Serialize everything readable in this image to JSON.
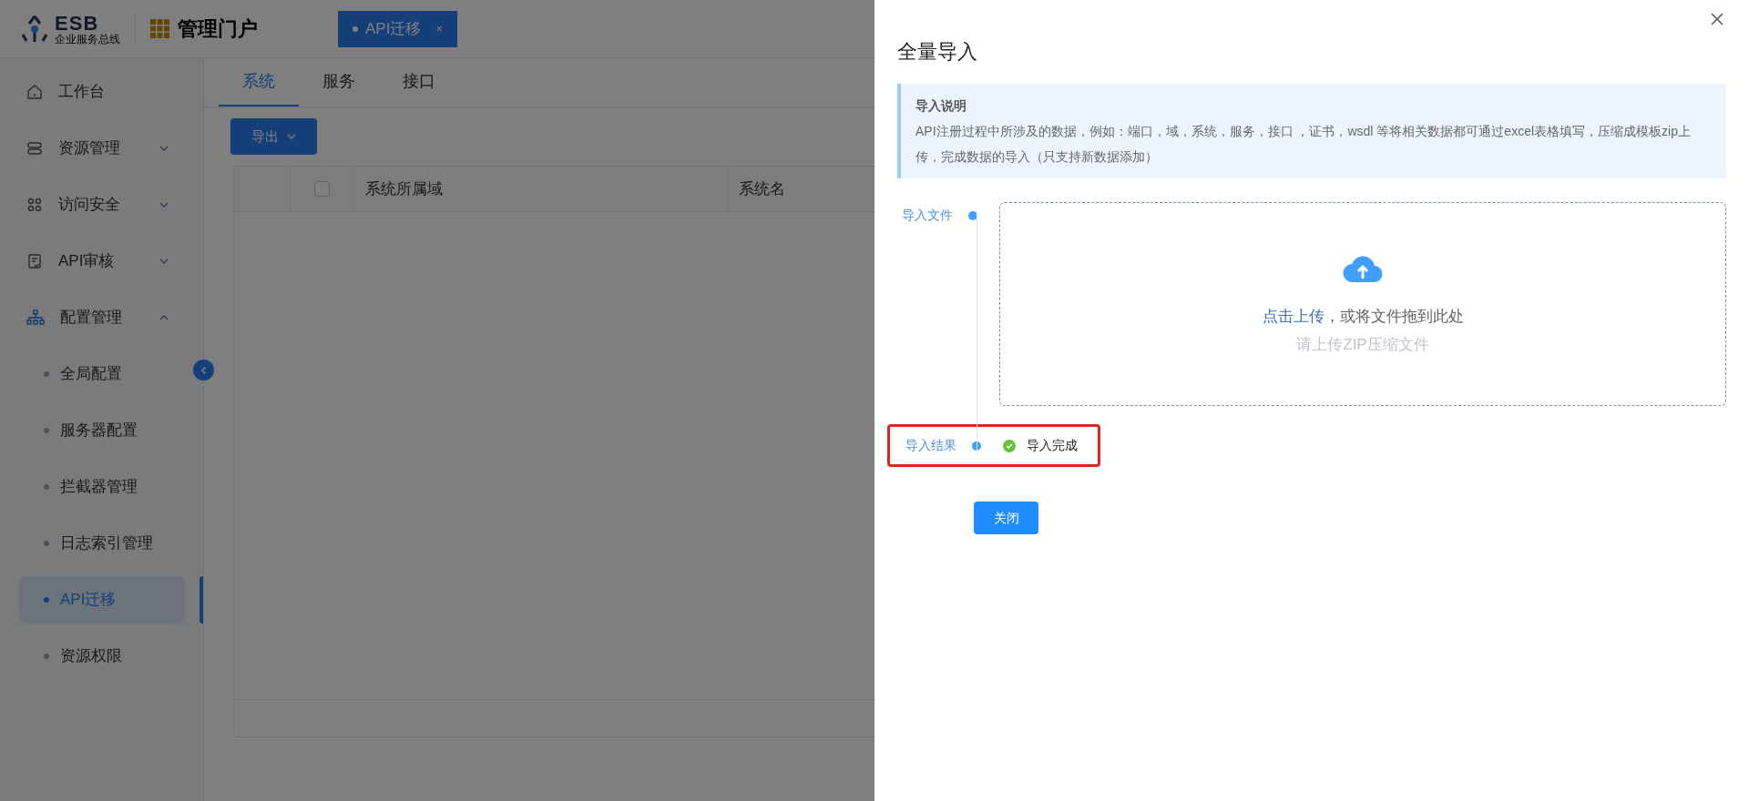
{
  "header": {
    "logo": {
      "title": "ESB",
      "subtitle": "企业服务总线"
    },
    "app_title": "管理门户",
    "open_tabs": [
      {
        "label": "API迁移",
        "selected": true,
        "close": "×"
      }
    ]
  },
  "sidebar": {
    "items": [
      {
        "label": "工作台"
      },
      {
        "label": "资源管理",
        "expanded": false
      },
      {
        "label": "访问安全",
        "expanded": false
      },
      {
        "label": "API审核",
        "expanded": false
      },
      {
        "label": "配置管理",
        "expanded": true,
        "children": [
          {
            "label": "全局配置",
            "selected": false
          },
          {
            "label": "服务器配置",
            "selected": false
          },
          {
            "label": "拦截器管理",
            "selected": false
          },
          {
            "label": "日志索引管理",
            "selected": false
          },
          {
            "label": "API迁移",
            "selected": true
          },
          {
            "label": "资源权限",
            "selected": false
          }
        ]
      }
    ]
  },
  "content": {
    "tabs": [
      {
        "label": "系统",
        "selected": true
      },
      {
        "label": "服务",
        "selected": false
      },
      {
        "label": "接口",
        "selected": false
      }
    ],
    "export_button": "导出",
    "table": {
      "select_all": {
        "checked": false
      },
      "columns": [
        "系统所属域",
        "系统名"
      ]
    }
  },
  "drawer": {
    "title": "全量导入",
    "notice": {
      "title": "导入说明",
      "text": "API注册过程中所涉及的数据，例如：端口，域，系统，服务，接口 ，证书，wsdl 等将相关数据都可通过excel表格填写，压缩成模板zip上传，完成数据的导入（只支持新数据添加）"
    },
    "steps": [
      {
        "label": "导入文件",
        "kind": "upload",
        "link": "点击上传",
        "text": "，或将文件拖到此处",
        "tip": "请上传ZIP压缩文件"
      },
      {
        "label": "导入结果",
        "kind": "result",
        "succeeded": true,
        "text": "导入完成",
        "highlighted": true
      }
    ],
    "close_button": "关闭"
  }
}
